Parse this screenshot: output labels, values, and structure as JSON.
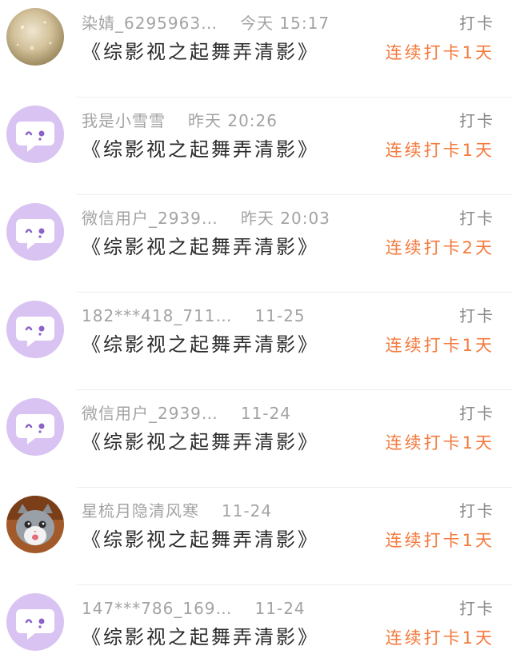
{
  "items": [
    {
      "username": "染婧_6295963…",
      "time": "今天 15:17",
      "title": "《综影视之起舞弄清影》",
      "action": "打卡",
      "streak": "连续打卡1天",
      "avatar": "photo-avatar-gold"
    },
    {
      "username": "我是小雪雪",
      "time": "昨天 20:26",
      "title": "《综影视之起舞弄清影》",
      "action": "打卡",
      "streak": "连续打卡1天",
      "avatar": "default-chat-avatar"
    },
    {
      "username": "微信用户_2939…",
      "time": "昨天 20:03",
      "title": "《综影视之起舞弄清影》",
      "action": "打卡",
      "streak": "连续打卡2天",
      "avatar": "default-chat-avatar"
    },
    {
      "username": "182***418_711…",
      "time": "11-25",
      "title": "《综影视之起舞弄清影》",
      "action": "打卡",
      "streak": "连续打卡1天",
      "avatar": "default-chat-avatar"
    },
    {
      "username": "微信用户_2939…",
      "time": "11-24",
      "title": "《综影视之起舞弄清影》",
      "action": "打卡",
      "streak": "连续打卡1天",
      "avatar": "default-chat-avatar"
    },
    {
      "username": "星梳月隐清风寒",
      "time": "11-24",
      "title": "《综影视之起舞弄清影》",
      "action": "打卡",
      "streak": "连续打卡1天",
      "avatar": "kitten-photo-avatar"
    },
    {
      "username": "147***786_169…",
      "time": "11-24",
      "title": "《综影视之起舞弄清影》",
      "action": "打卡",
      "streak": "连续打卡1天",
      "avatar": "default-chat-avatar"
    }
  ],
  "colors": {
    "accent": "#f47a3d",
    "meta_text": "#a3a3a3",
    "avatar_purple": "#d9c3f2",
    "avatar_icon": "#8a62c9"
  }
}
